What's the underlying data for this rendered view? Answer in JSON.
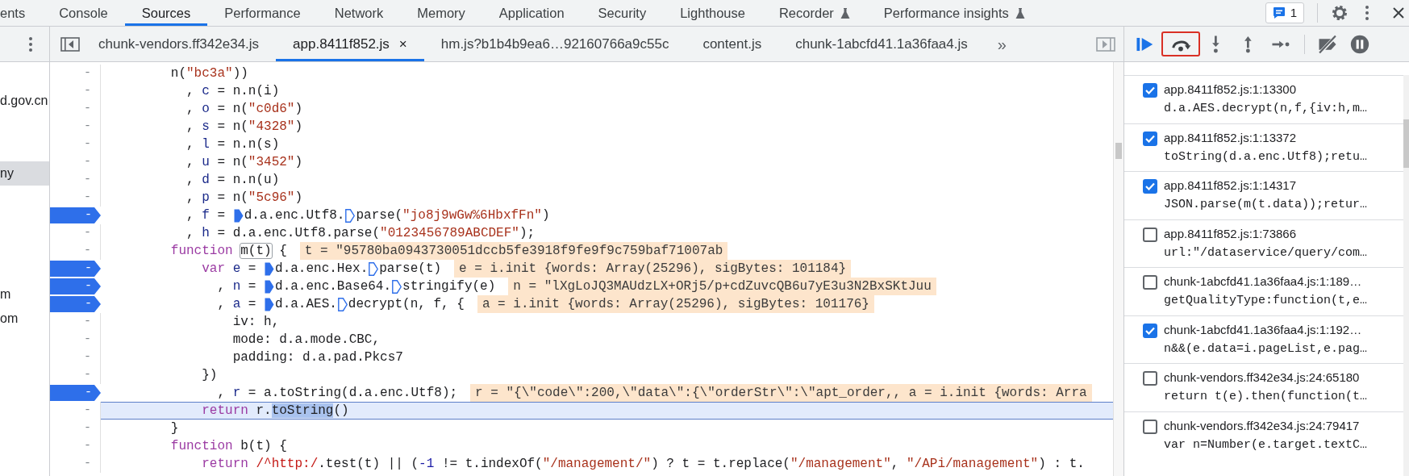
{
  "panel_tabs": [
    {
      "label": "ents",
      "selected": false,
      "experimental": false
    },
    {
      "label": "Console",
      "selected": false,
      "experimental": false
    },
    {
      "label": "Sources",
      "selected": true,
      "experimental": false
    },
    {
      "label": "Performance",
      "selected": false,
      "experimental": false
    },
    {
      "label": "Network",
      "selected": false,
      "experimental": false
    },
    {
      "label": "Memory",
      "selected": false,
      "experimental": false
    },
    {
      "label": "Application",
      "selected": false,
      "experimental": false
    },
    {
      "label": "Security",
      "selected": false,
      "experimental": false
    },
    {
      "label": "Lighthouse",
      "selected": false,
      "experimental": false
    },
    {
      "label": "Recorder",
      "selected": false,
      "experimental": true
    },
    {
      "label": "Performance insights",
      "selected": false,
      "experimental": true
    }
  ],
  "issues": {
    "count": "1"
  },
  "file_tabs": [
    {
      "label": "chunk-vendors.ff342e34.js",
      "selected": false
    },
    {
      "label": "app.8411f852.js",
      "selected": true,
      "close": "×"
    },
    {
      "label": "hm.js?b1b4b9ea6…92160766a9c55c",
      "selected": false
    },
    {
      "label": "content.js",
      "selected": false
    },
    {
      "label": "chunk-1abcfd41.1a36faa4.js",
      "selected": false
    }
  ],
  "more_tabs": "»",
  "debugger_controls": [
    {
      "kind": "resume",
      "highlighted": false
    },
    {
      "kind": "step_over",
      "highlighted": true
    },
    {
      "kind": "step_into",
      "highlighted": false
    },
    {
      "kind": "step_out",
      "highlighted": false
    },
    {
      "kind": "step",
      "highlighted": false
    },
    {
      "kind": "deactivate",
      "highlighted": false
    },
    {
      "kind": "pause_exceptions",
      "highlighted": false
    }
  ],
  "navigator": [
    {
      "text": "d.gov.cn",
      "selected": false
    },
    {
      "text": "ny",
      "selected": true
    },
    {
      "text": "m",
      "selected": false
    },
    {
      "text": "om",
      "selected": false
    }
  ],
  "code_lines": [
    {
      "gutter": "-",
      "breakpoint": false,
      "current": false,
      "parts": [
        {
          "kind": "text",
          "spans": [
            {
              "kind": "plain",
              "text": "        n("
            },
            {
              "kind": "string",
              "text": "\"bc3a\""
            },
            {
              "kind": "plain",
              "text": "))"
            }
          ]
        }
      ]
    },
    {
      "gutter": "-",
      "breakpoint": false,
      "current": false,
      "parts": [
        {
          "kind": "text",
          "spans": [
            {
              "kind": "plain",
              "text": "          , "
            },
            {
              "kind": "def",
              "text": "c"
            },
            {
              "kind": "plain",
              "text": " = n.n(i)"
            }
          ]
        }
      ]
    },
    {
      "gutter": "-",
      "breakpoint": false,
      "current": false,
      "parts": [
        {
          "kind": "text",
          "spans": [
            {
              "kind": "plain",
              "text": "          , "
            },
            {
              "kind": "def",
              "text": "o"
            },
            {
              "kind": "plain",
              "text": " = n("
            },
            {
              "kind": "string",
              "text": "\"c0d6\""
            },
            {
              "kind": "plain",
              "text": ")"
            }
          ]
        }
      ]
    },
    {
      "gutter": "-",
      "breakpoint": false,
      "current": false,
      "parts": [
        {
          "kind": "text",
          "spans": [
            {
              "kind": "plain",
              "text": "          , "
            },
            {
              "kind": "def",
              "text": "s"
            },
            {
              "kind": "plain",
              "text": " = n("
            },
            {
              "kind": "string",
              "text": "\"4328\""
            },
            {
              "kind": "plain",
              "text": ")"
            }
          ]
        }
      ]
    },
    {
      "gutter": "-",
      "breakpoint": false,
      "current": false,
      "parts": [
        {
          "kind": "text",
          "spans": [
            {
              "kind": "plain",
              "text": "          , "
            },
            {
              "kind": "def",
              "text": "l"
            },
            {
              "kind": "plain",
              "text": " = n.n(s)"
            }
          ]
        }
      ]
    },
    {
      "gutter": "-",
      "breakpoint": false,
      "current": false,
      "parts": [
        {
          "kind": "text",
          "spans": [
            {
              "kind": "plain",
              "text": "          , "
            },
            {
              "kind": "def",
              "text": "u"
            },
            {
              "kind": "plain",
              "text": " = n("
            },
            {
              "kind": "string",
              "text": "\"3452\""
            },
            {
              "kind": "plain",
              "text": ")"
            }
          ]
        }
      ]
    },
    {
      "gutter": "-",
      "breakpoint": false,
      "current": false,
      "parts": [
        {
          "kind": "text",
          "spans": [
            {
              "kind": "plain",
              "text": "          , "
            },
            {
              "kind": "def",
              "text": "d"
            },
            {
              "kind": "plain",
              "text": " = n.n(u)"
            }
          ]
        }
      ]
    },
    {
      "gutter": "-",
      "breakpoint": false,
      "current": false,
      "parts": [
        {
          "kind": "text",
          "spans": [
            {
              "kind": "plain",
              "text": "          , "
            },
            {
              "kind": "def",
              "text": "p"
            },
            {
              "kind": "plain",
              "text": " = n("
            },
            {
              "kind": "string",
              "text": "\"5c96\""
            },
            {
              "kind": "plain",
              "text": ")"
            }
          ]
        }
      ]
    },
    {
      "gutter": "-",
      "breakpoint": true,
      "current": false,
      "parts": [
        {
          "kind": "text",
          "spans": [
            {
              "kind": "plain",
              "text": "          , "
            },
            {
              "kind": "def",
              "text": "f"
            },
            {
              "kind": "plain",
              "text": " = "
            }
          ]
        },
        {
          "kind": "marker",
          "active": true
        },
        {
          "kind": "text",
          "spans": [
            {
              "kind": "plain",
              "text": "d.a.enc.Utf8."
            }
          ]
        },
        {
          "kind": "marker",
          "active": false
        },
        {
          "kind": "text",
          "spans": [
            {
              "kind": "plain",
              "text": "parse("
            },
            {
              "kind": "string",
              "text": "\"jo8j9wGw%6HbxfFn\""
            },
            {
              "kind": "plain",
              "text": ")"
            }
          ]
        }
      ]
    },
    {
      "gutter": "-",
      "breakpoint": false,
      "current": false,
      "parts": [
        {
          "kind": "text",
          "spans": [
            {
              "kind": "plain",
              "text": "          , "
            },
            {
              "kind": "def",
              "text": "h"
            },
            {
              "kind": "plain",
              "text": " = d.a.enc.Utf8.parse("
            },
            {
              "kind": "string",
              "text": "\"0123456789ABCDEF\""
            },
            {
              "kind": "plain",
              "text": ");"
            }
          ]
        }
      ]
    },
    {
      "gutter": "-",
      "breakpoint": false,
      "current": false,
      "parts": [
        {
          "kind": "text",
          "spans": [
            {
              "kind": "keyword",
              "text": "        function "
            },
            {
              "kind": "framed",
              "text": "m(t)"
            },
            {
              "kind": "plain",
              "text": " {"
            }
          ]
        },
        {
          "kind": "value",
          "text": "t = \"95780ba0943730051dccb5fe3918f9fe9f9c759baf71007ab"
        }
      ]
    },
    {
      "gutter": "-",
      "breakpoint": true,
      "current": false,
      "parts": [
        {
          "kind": "text",
          "spans": [
            {
              "kind": "keyword",
              "text": "            var "
            },
            {
              "kind": "def",
              "text": "e"
            },
            {
              "kind": "plain",
              "text": " = "
            }
          ]
        },
        {
          "kind": "marker",
          "active": true
        },
        {
          "kind": "text",
          "spans": [
            {
              "kind": "plain",
              "text": "d.a.enc.Hex."
            }
          ]
        },
        {
          "kind": "marker",
          "active": false
        },
        {
          "kind": "text",
          "spans": [
            {
              "kind": "plain",
              "text": "parse(t)"
            }
          ]
        },
        {
          "kind": "value",
          "text": "e = i.init {words: Array(25296), sigBytes: 101184}"
        }
      ]
    },
    {
      "gutter": "-",
      "breakpoint": true,
      "current": false,
      "parts": [
        {
          "kind": "text",
          "spans": [
            {
              "kind": "plain",
              "text": "              , "
            },
            {
              "kind": "def",
              "text": "n"
            },
            {
              "kind": "plain",
              "text": " = "
            }
          ]
        },
        {
          "kind": "marker",
          "active": true
        },
        {
          "kind": "text",
          "spans": [
            {
              "kind": "plain",
              "text": "d.a.enc.Base64."
            }
          ]
        },
        {
          "kind": "marker",
          "active": false
        },
        {
          "kind": "text",
          "spans": [
            {
              "kind": "plain",
              "text": "stringify(e)"
            }
          ]
        },
        {
          "kind": "value",
          "text": "n = \"lXgLoJQ3MAUdzLX+ORj5/p+cdZuvcQB6u7yE3u3N2BxSKtJuu"
        }
      ]
    },
    {
      "gutter": "-",
      "breakpoint": true,
      "current": false,
      "parts": [
        {
          "kind": "text",
          "spans": [
            {
              "kind": "plain",
              "text": "              , "
            },
            {
              "kind": "def",
              "text": "a"
            },
            {
              "kind": "plain",
              "text": " = "
            }
          ]
        },
        {
          "kind": "marker",
          "active": true
        },
        {
          "kind": "text",
          "spans": [
            {
              "kind": "plain",
              "text": "d.a.AES."
            }
          ]
        },
        {
          "kind": "marker",
          "active": false
        },
        {
          "kind": "text",
          "spans": [
            {
              "kind": "plain",
              "text": "decrypt(n, f, {"
            }
          ]
        },
        {
          "kind": "value",
          "text": "a = i.init {words: Array(25296), sigBytes: 101176}"
        }
      ]
    },
    {
      "gutter": "-",
      "breakpoint": false,
      "current": false,
      "parts": [
        {
          "kind": "text",
          "spans": [
            {
              "kind": "plain",
              "text": "                iv: h,"
            }
          ]
        }
      ]
    },
    {
      "gutter": "-",
      "breakpoint": false,
      "current": false,
      "parts": [
        {
          "kind": "text",
          "spans": [
            {
              "kind": "plain",
              "text": "                mode: d.a.mode.CBC,"
            }
          ]
        }
      ]
    },
    {
      "gutter": "-",
      "breakpoint": false,
      "current": false,
      "parts": [
        {
          "kind": "text",
          "spans": [
            {
              "kind": "plain",
              "text": "                padding: d.a.pad.Pkcs7"
            }
          ]
        }
      ]
    },
    {
      "gutter": "-",
      "breakpoint": false,
      "current": false,
      "parts": [
        {
          "kind": "text",
          "spans": [
            {
              "kind": "plain",
              "text": "            })"
            }
          ]
        }
      ]
    },
    {
      "gutter": "-",
      "breakpoint": true,
      "current": false,
      "parts": [
        {
          "kind": "text",
          "spans": [
            {
              "kind": "plain",
              "text": "              , "
            },
            {
              "kind": "def",
              "text": "r"
            },
            {
              "kind": "plain",
              "text": " = a.toString(d.a.enc.Utf8);"
            }
          ]
        },
        {
          "kind": "value",
          "text": "r = \"{\\\"code\\\":200,\\\"data\\\":{\\\"orderStr\\\":\\\"apt_order,, a = i.init {words: Arra"
        }
      ]
    },
    {
      "gutter": "-",
      "breakpoint": false,
      "current": true,
      "parts": [
        {
          "kind": "text",
          "spans": [
            {
              "kind": "keyword",
              "text": "            return "
            },
            {
              "kind": "plain",
              "text": "r."
            },
            {
              "kind": "selection",
              "text": "toString"
            },
            {
              "kind": "plain",
              "text": "()"
            }
          ]
        }
      ]
    },
    {
      "gutter": "-",
      "breakpoint": false,
      "current": false,
      "parts": [
        {
          "kind": "text",
          "spans": [
            {
              "kind": "plain",
              "text": "        }"
            }
          ]
        }
      ]
    },
    {
      "gutter": "-",
      "breakpoint": false,
      "current": false,
      "parts": [
        {
          "kind": "text",
          "spans": [
            {
              "kind": "keyword",
              "text": "        function "
            },
            {
              "kind": "plain",
              "text": "b(t) {"
            }
          ]
        }
      ]
    },
    {
      "gutter": "-",
      "breakpoint": false,
      "current": false,
      "parts": [
        {
          "kind": "text",
          "spans": [
            {
              "kind": "keyword",
              "text": "            return "
            },
            {
              "kind": "regex",
              "text": "/^http:/"
            },
            {
              "kind": "plain",
              "text": ".test(t) || ("
            },
            {
              "kind": "number",
              "text": "-1"
            },
            {
              "kind": "plain",
              "text": " != t.indexOf("
            },
            {
              "kind": "string",
              "text": "\"/management/\""
            },
            {
              "kind": "plain",
              "text": ") ? t = t.replace("
            },
            {
              "kind": "string",
              "text": "\"/management\""
            },
            {
              "kind": "plain",
              "text": ", "
            },
            {
              "kind": "string",
              "text": "\"/APi/management\""
            },
            {
              "kind": "plain",
              "text": ") : t."
            }
          ]
        }
      ]
    }
  ],
  "breakpoints": [
    {
      "location": "app.8411f852.js:1:13300",
      "code": "d.a.AES.decrypt(n,f,{iv:h,m…",
      "checked": true
    },
    {
      "location": "app.8411f852.js:1:13372",
      "code": "toString(d.a.enc.Utf8);retu…",
      "checked": true
    },
    {
      "location": "app.8411f852.js:1:14317",
      "code": "JSON.parse(m(t.data));retur…",
      "checked": true
    },
    {
      "location": "app.8411f852.js:1:73866",
      "code": "url:\"/dataservice/query/com…",
      "checked": false
    },
    {
      "location": "chunk-1abcfd41.1a36faa4.js:1:189…",
      "code": "getQualityType:function(t,e…",
      "checked": false
    },
    {
      "location": "chunk-1abcfd41.1a36faa4.js:1:192…",
      "code": "n&&(e.data=i.pageList,e.pag…",
      "checked": true
    },
    {
      "location": "chunk-vendors.ff342e34.js:24:65180",
      "code": "return t(e).then(function(t…",
      "checked": false
    },
    {
      "location": "chunk-vendors.ff342e34.js:24:79417",
      "code": "var n=Number(e.target.textC…",
      "checked": false
    }
  ]
}
